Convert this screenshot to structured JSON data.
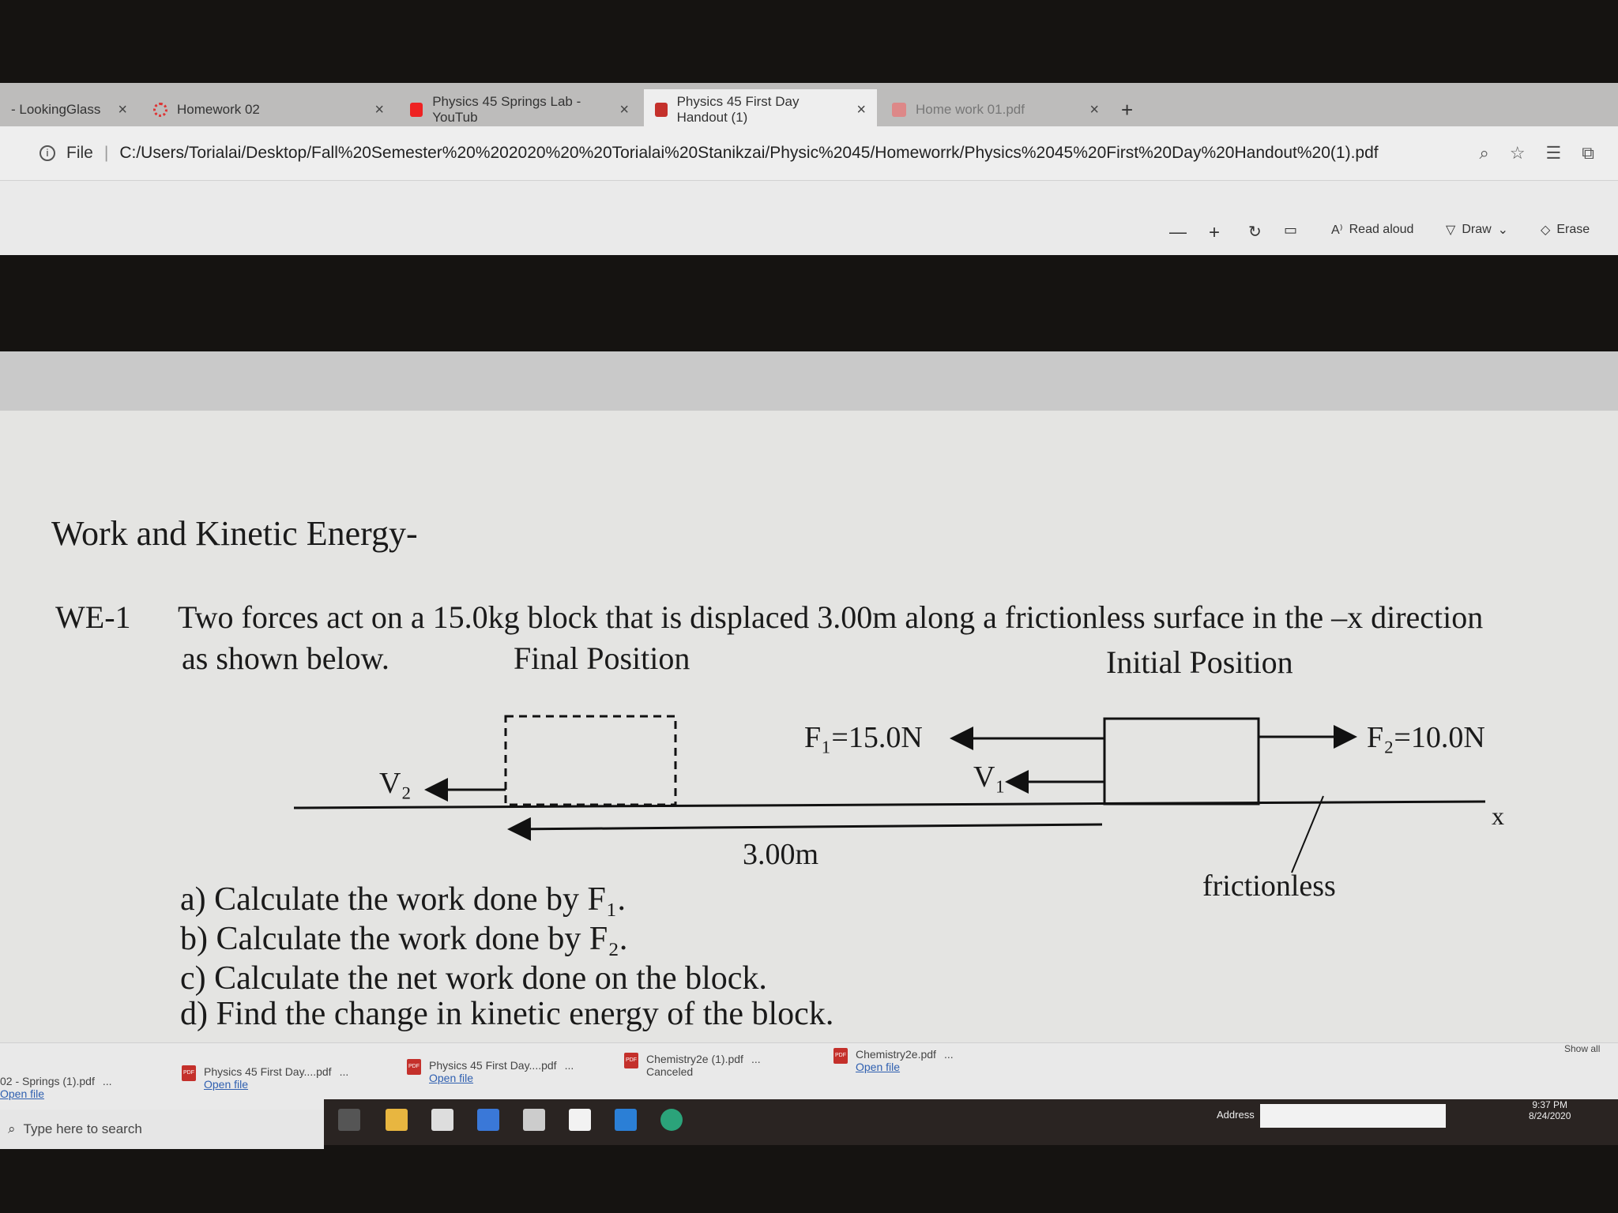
{
  "browser": {
    "tabs": [
      {
        "label": "- LookingGlass",
        "icon": "none"
      },
      {
        "label": "Homework 02",
        "icon": "canvas-icon"
      },
      {
        "label": "Physics 45 Springs Lab - YouTub",
        "icon": "youtube-icon"
      },
      {
        "label": "Physics 45 First Day Handout (1)",
        "icon": "pdf-icon",
        "active": true
      },
      {
        "label": "Home work 01.pdf",
        "icon": "pdf-icon"
      }
    ],
    "new_tab": "+",
    "address": {
      "scheme": "File",
      "url": "C:/Users/Torialai/Desktop/Fall%20Semester%20%202020%20%20Torialai%20Stanikzai/Physic%2045/Homeworrk/Physics%2045%20First%20Day%20Handout%20(1).pdf"
    },
    "toolbar": {
      "zoom_out": "—",
      "zoom_in": "+",
      "read_aloud": "Read aloud",
      "draw": "Draw",
      "erase": "Erase"
    }
  },
  "document": {
    "title": "Work and Kinetic Energy-",
    "problem_id": "WE-1",
    "problem_line1": "Two forces act on a 15.0kg block that is displaced 3.00m along a frictionless surface in the –x direction",
    "problem_line2": "as shown below.",
    "final_position": "Final Position",
    "initial_position": "Initial Position",
    "diagram": {
      "f1": "F₁=15.0N",
      "f2": "F₂=10.0N",
      "v1": "V₁",
      "v2": "V₂",
      "displacement": "3.00m",
      "axis": "x",
      "surface": "frictionless"
    },
    "questions": [
      "a) Calculate the work done by F₁.",
      "b) Calculate the work done by F₂.",
      "c) Calculate the net work done on the block.",
      "d) Find the change in kinetic energy of the block."
    ]
  },
  "downloads": {
    "items": [
      {
        "name": "02 - Springs (1).pdf",
        "action": "Open file"
      },
      {
        "name": "Physics 45 First Day....pdf",
        "action": "Open file"
      },
      {
        "name": "Physics 45 First Day....pdf",
        "action": "Open file"
      },
      {
        "name": "Chemistry2e (1).pdf",
        "status": "Canceled"
      },
      {
        "name": "Chemistry2e.pdf",
        "action": "Open file"
      }
    ],
    "more": "...",
    "show_all": "Show all"
  },
  "taskbar": {
    "search_placeholder": "Type here to search",
    "address_label": "Address",
    "time": "9:37 PM",
    "date": "8/24/2020"
  }
}
